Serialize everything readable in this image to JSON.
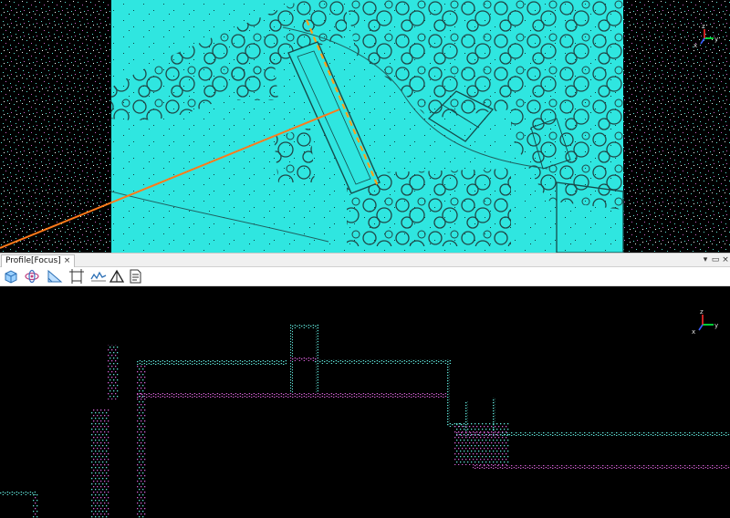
{
  "profile_tab": {
    "label": "Profile[Focus]",
    "close_glyph": "×"
  },
  "panel_controls": {
    "dropdown_glyph": "▾",
    "float_glyph": "▭",
    "close_glyph": "×"
  },
  "toolbar": {
    "tools": [
      {
        "icon": "3d-box-icon"
      },
      {
        "icon": "rotate-orbit-icon"
      },
      {
        "icon": "measure-slope-icon"
      },
      {
        "icon": "crop-bounds-icon"
      },
      {
        "icon": "profile-wave-icon"
      },
      {
        "icon": "triangle-icon"
      },
      {
        "icon": "report-document-icon"
      }
    ]
  },
  "axes_labels": {
    "x": "x",
    "y": "y",
    "z": "z"
  },
  "colors": {
    "surface": "#2fe6e0",
    "points_cyan": "#5fe3d8",
    "points_magenta": "#d25fd2",
    "section_line": "#ff7a1a",
    "dashed_line": "#ffa21a"
  }
}
